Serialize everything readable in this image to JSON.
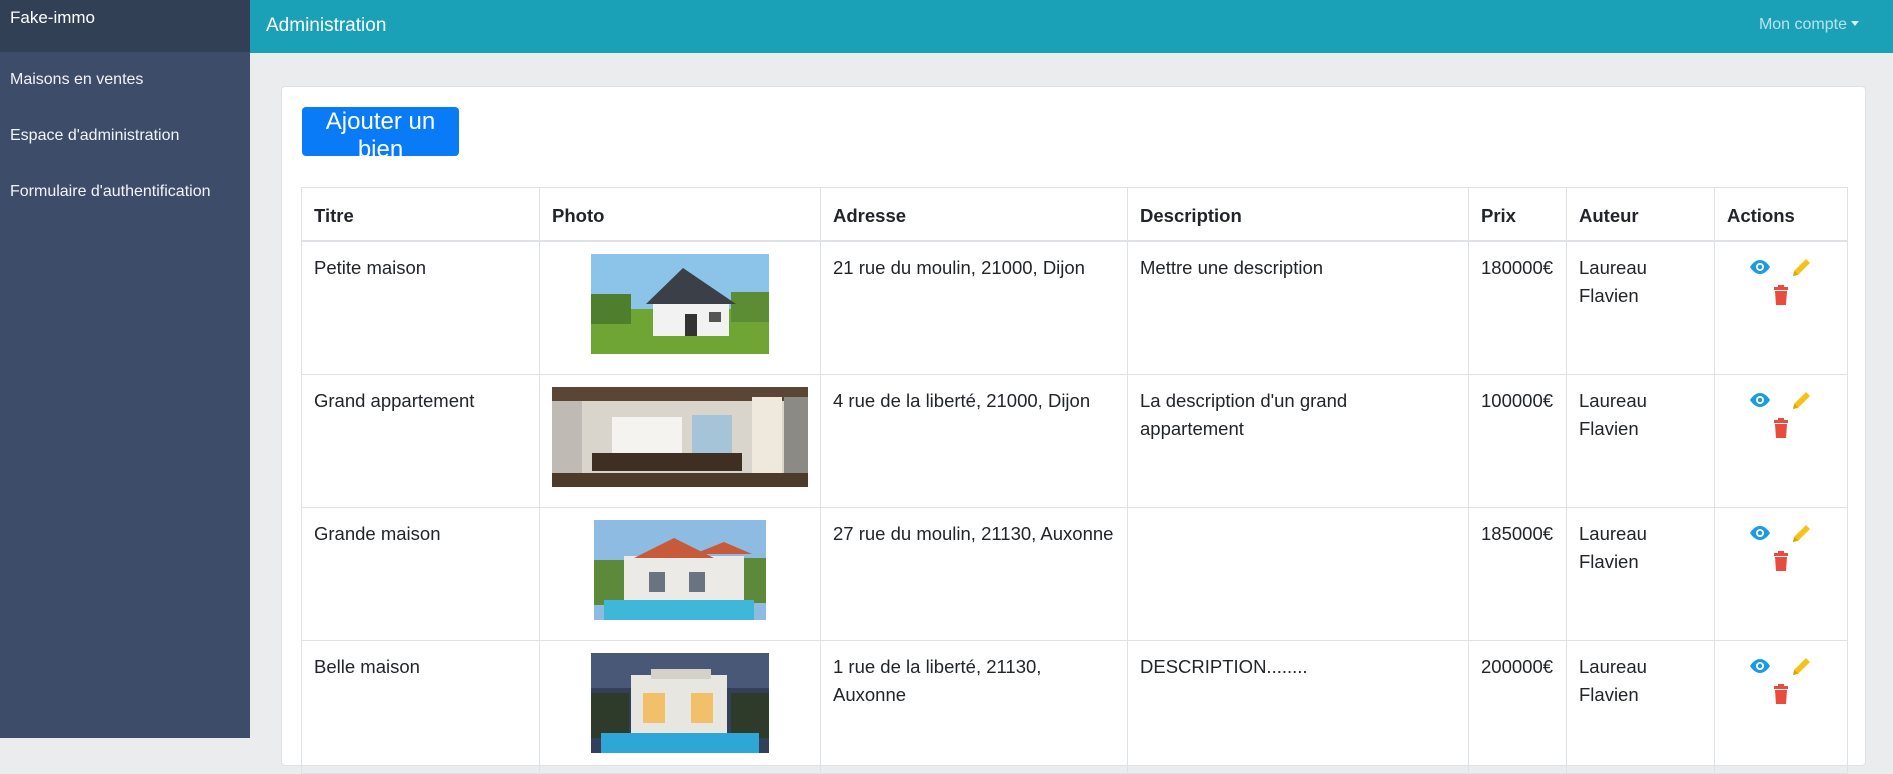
{
  "sidebar": {
    "brand": "Fake-immo",
    "items": [
      {
        "label": "Maisons en ventes"
      },
      {
        "label": "Espace d'administration"
      },
      {
        "label": "Formulaire d'authentification"
      }
    ]
  },
  "header": {
    "title": "Administration",
    "account": "Mon compte"
  },
  "main": {
    "add_button": "Ajouter un bien",
    "columns": [
      "Titre",
      "Photo",
      "Adresse",
      "Description",
      "Prix",
      "Auteur",
      "Actions"
    ],
    "rows": [
      {
        "titre": "Petite maison",
        "adresse": "21 rue du moulin, 21000, Dijon",
        "description": "Mettre une description",
        "prix": "180000€",
        "auteur": "Laureau Flavien"
      },
      {
        "titre": "Grand appartement",
        "adresse": "4 rue de la liberté, 21000, Dijon",
        "description": "La description d'un grand appartement",
        "prix": "100000€",
        "auteur": "Laureau Flavien"
      },
      {
        "titre": "Grande maison",
        "adresse": "27 rue du moulin, 21130, Auxonne",
        "description": "",
        "prix": "185000€",
        "auteur": "Laureau Flavien"
      },
      {
        "titre": "Belle maison",
        "adresse": "1 rue de la liberté, 21130, Auxonne",
        "description": "DESCRIPTION........",
        "prix": "200000€",
        "auteur": "Laureau Flavien"
      }
    ]
  },
  "colors": {
    "view": "#1b9be0",
    "edit": "#f5c21b",
    "delete": "#e74c3c",
    "primary": "#0a7bf7",
    "topbar": "#1aa1b8",
    "sidebar": "#3d4c69"
  },
  "icons": {
    "view": "eye-icon",
    "edit": "pencil-icon",
    "delete": "trash-icon",
    "account": "caret-down-icon"
  }
}
